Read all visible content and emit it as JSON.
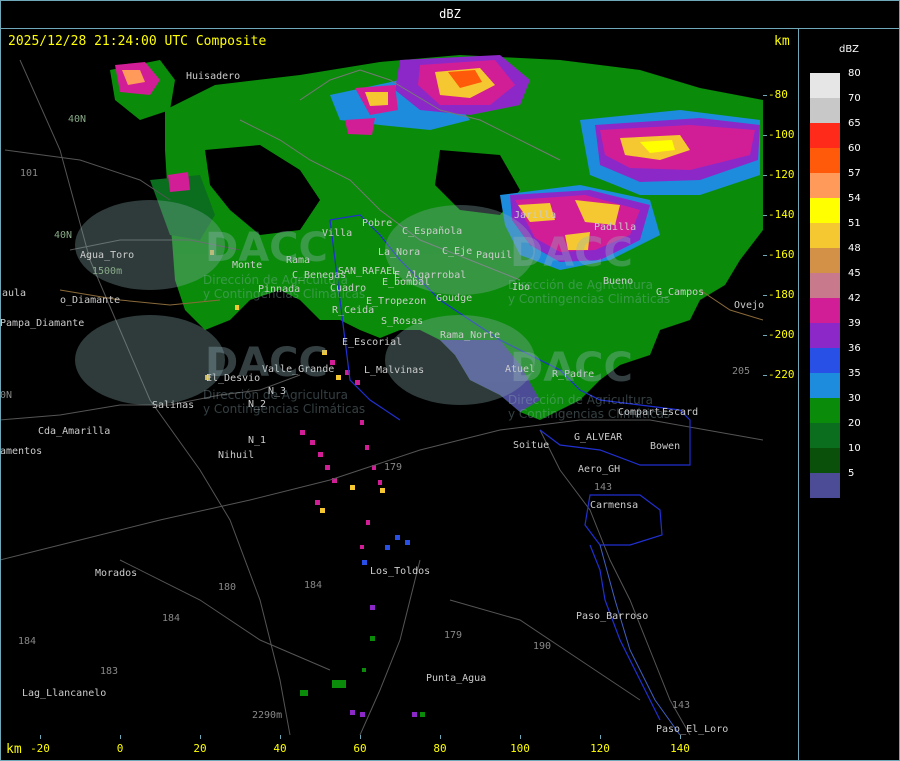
{
  "header": {
    "unit_title": "dBZ",
    "timestamp": "2025/12/28 21:24:00 UTC Composite",
    "km_top": "km",
    "km_bottom": "km"
  },
  "axes": {
    "y_ticks": [
      "-80",
      "-100",
      "-120",
      "-140",
      "-160",
      "-180",
      "-200",
      "-220"
    ],
    "x_ticks": [
      "-20",
      "0",
      "20",
      "40",
      "60",
      "80",
      "100",
      "120",
      "140"
    ]
  },
  "legend": {
    "title": "dBZ",
    "entries": [
      {
        "value": "80",
        "color": "#e6e6e6"
      },
      {
        "value": "70",
        "color": "#c8c8c8"
      },
      {
        "value": "65",
        "color": "#ff2a1a"
      },
      {
        "value": "60",
        "color": "#ff5a0a"
      },
      {
        "value": "57",
        "color": "#ff9a5a"
      },
      {
        "value": "54",
        "color": "#ffff00"
      },
      {
        "value": "51",
        "color": "#f5c832"
      },
      {
        "value": "48",
        "color": "#d29146"
      },
      {
        "value": "45",
        "color": "#c87a8c"
      },
      {
        "value": "42",
        "color": "#d21e96"
      },
      {
        "value": "39",
        "color": "#8c28c8"
      },
      {
        "value": "36",
        "color": "#2850e6"
      },
      {
        "value": "35",
        "color": "#1e8cdc"
      },
      {
        "value": "30",
        "color": "#0a8c0a"
      },
      {
        "value": "20",
        "color": "#0a6e1e"
      },
      {
        "value": "10",
        "color": "#0a500a"
      },
      {
        "value": "5",
        "color": "#4b4b96"
      }
    ]
  },
  "places": [
    {
      "name": "Huisadero"
    },
    {
      "name": "40N"
    },
    {
      "name": "101"
    },
    {
      "name": "40N"
    },
    {
      "name": "Agua_Toro"
    },
    {
      "name": "1500m"
    },
    {
      "name": "aula"
    },
    {
      "name": "o_Diamante"
    },
    {
      "name": "Pampa_Diamante"
    },
    {
      "name": "amentos"
    },
    {
      "name": "Cda_Amarilla"
    },
    {
      "name": "0N"
    },
    {
      "name": "Salinas"
    },
    {
      "name": "El_Desvio"
    },
    {
      "name": "Valle_Grande"
    },
    {
      "name": "N_3"
    },
    {
      "name": "N_2"
    },
    {
      "name": "N_1"
    },
    {
      "name": "Nihuil"
    },
    {
      "name": "Morados"
    },
    {
      "name": "180"
    },
    {
      "name": "184"
    },
    {
      "name": "184"
    },
    {
      "name": "183"
    },
    {
      "name": "Lag_Llancanelo"
    },
    {
      "name": "2290m"
    },
    {
      "name": "184"
    },
    {
      "name": "Los_Toldos"
    },
    {
      "name": "179"
    },
    {
      "name": "179"
    },
    {
      "name": "Punta_Agua"
    },
    {
      "name": "190"
    },
    {
      "name": "Paso_Barroso"
    },
    {
      "name": "143"
    },
    {
      "name": "Paso_El_Loro"
    },
    {
      "name": "143"
    },
    {
      "name": "Carmensa"
    },
    {
      "name": "Aero_GH"
    },
    {
      "name": "Soitue"
    },
    {
      "name": "G_ALVEAR"
    },
    {
      "name": "Bowen"
    },
    {
      "name": "Compart"
    },
    {
      "name": "Escard"
    },
    {
      "name": "R_Padre"
    },
    {
      "name": "Atuel"
    },
    {
      "name": "L_Malvinas"
    },
    {
      "name": "E_Escorial"
    },
    {
      "name": "S_Rosas"
    },
    {
      "name": "R_Ceida"
    },
    {
      "name": "Rama_Norte"
    },
    {
      "name": "E_Tropezon"
    },
    {
      "name": "Goudge"
    },
    {
      "name": "E_bombal"
    },
    {
      "name": "SAN_RAFAEL"
    },
    {
      "name": "C_Benegas"
    },
    {
      "name": "E_Algarrobal"
    },
    {
      "name": "La_Nora"
    },
    {
      "name": "C_Española"
    },
    {
      "name": "Pobre"
    },
    {
      "name": "Villa"
    },
    {
      "name": "C_Eje"
    },
    {
      "name": "Paquil"
    },
    {
      "name": "Monte"
    },
    {
      "name": "Pinnada"
    },
    {
      "name": "Rama"
    },
    {
      "name": "Cuadro"
    },
    {
      "name": "Jarilla"
    },
    {
      "name": "Padilla"
    },
    {
      "name": "Ovejo"
    },
    {
      "name": "G_Campos"
    },
    {
      "name": "205"
    },
    {
      "name": "Bueno"
    },
    {
      "name": "Ibo"
    }
  ],
  "watermarks": {
    "logo": "DACC",
    "line1": "Dirección de Agricultura",
    "line2": "y Contingencias Climáticas"
  }
}
